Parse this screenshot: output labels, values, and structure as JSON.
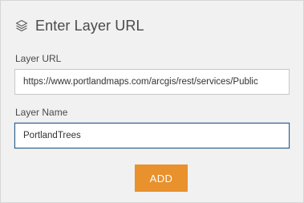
{
  "header": {
    "title": "Enter Layer URL",
    "icon": "layers-icon"
  },
  "form": {
    "url_label": "Layer URL",
    "url_value": "https://www.portlandmaps.com/arcgis/rest/services/Public",
    "name_label": "Layer Name",
    "name_value": "PortlandTrees"
  },
  "actions": {
    "add_label": "ADD"
  },
  "colors": {
    "accent": "#e8912d",
    "focus_border": "#2b5b8a",
    "panel_bg": "#f1f1f1"
  }
}
